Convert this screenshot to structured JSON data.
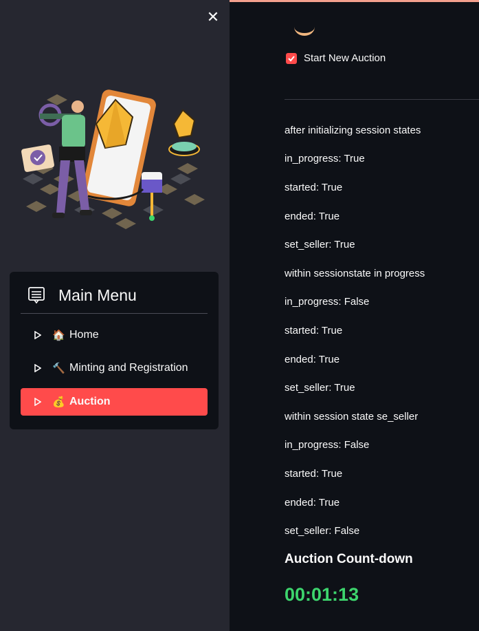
{
  "sidebar": {
    "close_icon": "close-icon",
    "menu_title": "Main Menu",
    "menu_icon": "menu-lines-icon",
    "items": [
      {
        "label": "Home",
        "emoji": "🏠",
        "active": false
      },
      {
        "label": "Minting and Registration",
        "emoji": "🔨",
        "active": false
      },
      {
        "label": "Auction",
        "emoji": "💰",
        "active": true
      }
    ]
  },
  "main": {
    "checkbox": {
      "label": "Start New Auction",
      "checked": true
    },
    "log_lines": [
      "after initializing session states",
      "in_progress: True",
      "started: True",
      "ended: True",
      "set_seller: True",
      "within sessionstate in progress",
      "in_progress: False",
      "started: True",
      "ended: True",
      "set_seller: True",
      "within session state se_seller",
      "in_progress: False",
      "started: True",
      "ended: True",
      "set_seller: False"
    ],
    "countdown_title": "Auction Count-down",
    "countdown_value": "00:01:13"
  },
  "colors": {
    "accent": "#ff4b4b",
    "sidebar_bg": "#262730",
    "main_bg": "#0e1117",
    "countdown_green": "#3dd56d"
  }
}
